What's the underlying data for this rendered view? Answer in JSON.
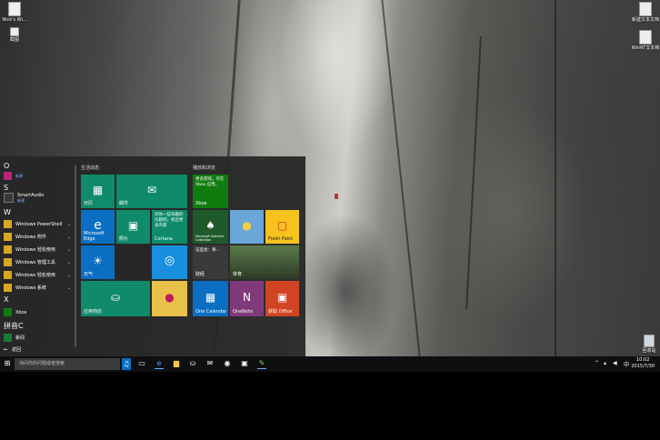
{
  "desktop": {
    "icons": [
      {
        "name": "desktop-icon-topleft",
        "label": "Nick's Wi..."
      },
      {
        "name": "desktop-icon-left-2",
        "label": "截图"
      },
      {
        "name": "desktop-icon-right-1",
        "label": "新建文本文档"
      },
      {
        "name": "desktop-icon-right-2",
        "label": "WinRT文本档"
      },
      {
        "name": "recycle-bin",
        "label": "回收站"
      }
    ]
  },
  "start": {
    "letters": {
      "o": "O",
      "s": "S",
      "w": "W",
      "x": "X",
      "pinyin": "拼音C"
    },
    "apps": [
      {
        "label": "",
        "sub": "新建"
      },
      {
        "label": "SmartAudio",
        "sub": "新建"
      },
      {
        "label": "Windows PowerShell"
      },
      {
        "label": "Windows 附件"
      },
      {
        "label": "Windows 轻松使用"
      },
      {
        "label": "Windows 管理工具"
      },
      {
        "label": "Windows 轻松使用"
      },
      {
        "label": "Windows 系统"
      },
      {
        "label": "Xbox"
      },
      {
        "label": "新闻"
      }
    ],
    "back_label": "返回",
    "groups": {
      "left": "生活动态",
      "right": "播放和浏览"
    },
    "tiles": {
      "calendar": "日历",
      "mail": "邮件",
      "edge": "Microsoft Edge",
      "photos": "照片",
      "cortana_text": "问你一些有趣的问题吧，找出更多内容",
      "cortana": "Cortana",
      "weather": "天气",
      "qq": "",
      "store": "应用商店",
      "xbox_text": "更多游戏，尽在 Xbox 应用。",
      "xbox": "Xbox",
      "solitaire": "Microsoft Solitaire Collection",
      "freshpaint": "Fresh Paint",
      "news_text": "证监会：将…",
      "news": "财经",
      "sports": "体育",
      "onecalendar": "One Calendar",
      "onenote": "OneNote",
      "office": "获取 Office"
    }
  },
  "taskbar": {
    "search_placeholder": "询问你的问题或者搜索",
    "clock_time": "10:02",
    "clock_date": "2015/7/30",
    "ime": "中"
  },
  "colors": {
    "tile_green": "#0f8a6a",
    "tile_blue": "#0a6fc2",
    "taskbar": "#0f0f12"
  }
}
